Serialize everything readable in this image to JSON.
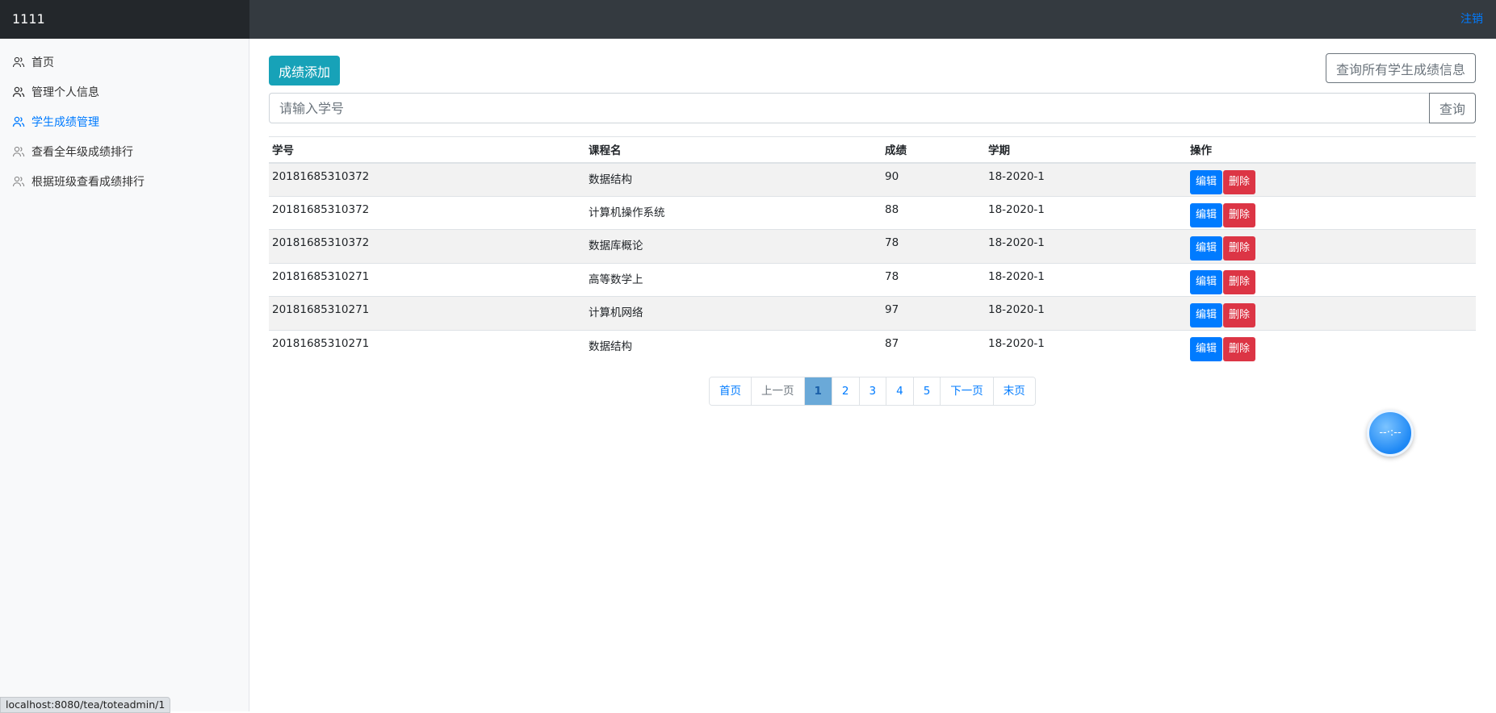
{
  "app": {
    "brand": "1111",
    "signout_label": "注销"
  },
  "sidebar": {
    "items": [
      {
        "label": "首页",
        "active": false
      },
      {
        "label": "管理个人信息",
        "active": false
      },
      {
        "label": "学生成绩管理",
        "active": true
      },
      {
        "label": "查看全年级成绩排行",
        "active": false
      },
      {
        "label": "根据班级查看成绩排行",
        "active": false
      }
    ]
  },
  "toolbar": {
    "add_label": "成绩添加",
    "query_all_label": "查询所有学生成绩信息",
    "search_placeholder": "请输入学号",
    "search_button": "查询"
  },
  "table": {
    "headers": [
      "学号",
      "课程名",
      "成绩",
      "学期",
      "操作"
    ],
    "rows": [
      [
        "20181685310372",
        "数据结构",
        "90",
        "18-2020-1"
      ],
      [
        "20181685310372",
        "计算机操作系统",
        "88",
        "18-2020-1"
      ],
      [
        "20181685310372",
        "数据库概论",
        "78",
        "18-2020-1"
      ],
      [
        "20181685310271",
        "高等数学上",
        "78",
        "18-2020-1"
      ],
      [
        "20181685310271",
        "计算机网络",
        "97",
        "18-2020-1"
      ],
      [
        "20181685310271",
        "数据结构",
        "87",
        "18-2020-1"
      ]
    ],
    "edit_label": "编辑",
    "delete_label": "删除"
  },
  "pagination": {
    "first": "首页",
    "prev": "上一页",
    "pages": [
      "1",
      "2",
      "3",
      "4",
      "5"
    ],
    "current": "1",
    "next": "下一页",
    "last": "末页"
  },
  "status_bar": {
    "url": "localhost:8080/tea/toteadmin/1"
  },
  "colors": {
    "accent": "#007bff",
    "add": "#17a2b8",
    "danger": "#dc3545",
    "navbar": "#343a40"
  }
}
